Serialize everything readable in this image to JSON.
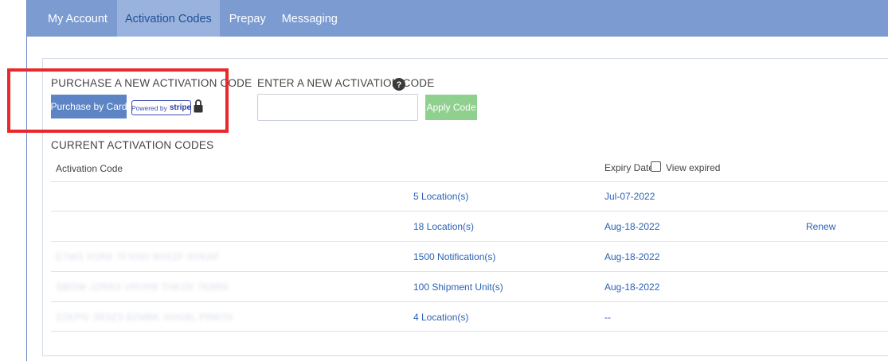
{
  "nav": {
    "items": [
      {
        "label": "My Account",
        "active": false
      },
      {
        "label": "Activation Codes",
        "active": true
      },
      {
        "label": "Prepay",
        "active": false
      },
      {
        "label": "Messaging",
        "active": false
      }
    ]
  },
  "purchase": {
    "title": "PURCHASE A NEW ACTIVATION CODE",
    "button_label": "Purchase by Card",
    "powered_by": "Powered by",
    "stripe": "stripe",
    "lock_icon": "lock-icon"
  },
  "enter": {
    "title": "ENTER A NEW ACTIVATION CODE",
    "help_icon": "question-circle-icon",
    "input_value": "",
    "input_placeholder": "",
    "apply_label": "Apply Code"
  },
  "current": {
    "title": "CURRENT ACTIVATION CODES",
    "headers": {
      "code": "Activation Code",
      "expiry": "Expiry Date",
      "view_expired": "View expired"
    },
    "rows": [
      {
        "code": "",
        "units": "5 Location(s)",
        "expiry": "Jul-07-2022",
        "action": ""
      },
      {
        "code": "",
        "units": "18 Location(s)",
        "expiry": "Aug-18-2022",
        "action": "Renew"
      },
      {
        "code": "E7W3 XSR6 7FXHH 9HXZF 8YKAF",
        "units": "1500 Notification(s)",
        "expiry": "Aug-18-2022",
        "action": ""
      },
      {
        "code": "SBGW JZRR3 VRVH9 THKZK 7K8R6",
        "units": "100 Shipment Unit(s)",
        "expiry": "Aug-18-2022",
        "action": ""
      },
      {
        "code": "ZZKPG 3R3Z3 8ZMBK XHG8L P8M7H",
        "units": "4 Location(s)",
        "expiry": "--",
        "action": ""
      }
    ]
  },
  "colors": {
    "nav_bg": "#7b9bd1",
    "nav_active_bg": "#9ab3de",
    "primary_button": "#5d84c4",
    "apply_button": "#8fd08e",
    "link": "#2b62b5",
    "highlight_border": "#e8282b"
  }
}
